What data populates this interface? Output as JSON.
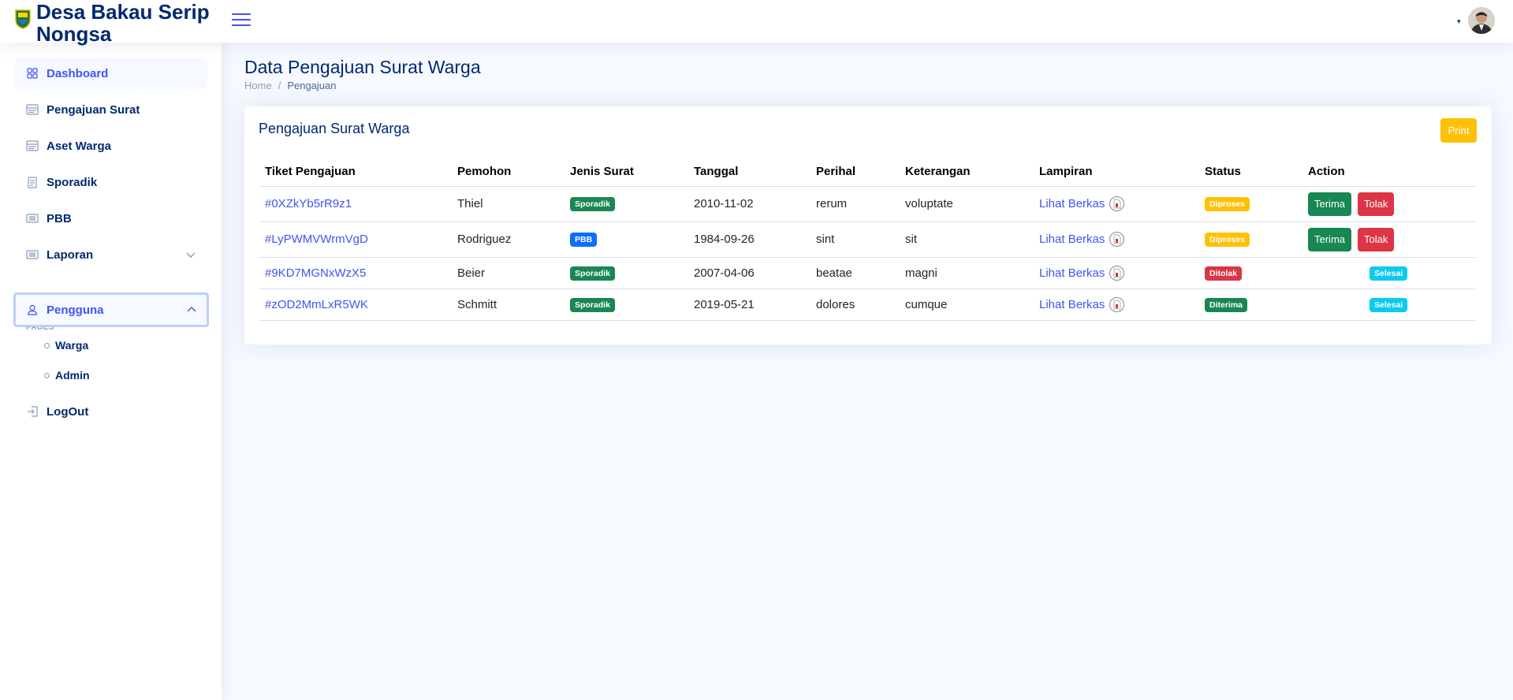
{
  "header": {
    "app_title": "Desa Bakau Serip Nongsa",
    "logo_icon": "village-emblem-icon",
    "menu_icon": "hamburger-icon",
    "profile_caret": "▾"
  },
  "sidebar": {
    "items": [
      {
        "label": "Dashboard",
        "icon": "grid-icon"
      },
      {
        "label": "Pengajuan Surat",
        "icon": "layout-text-icon"
      },
      {
        "label": "Aset Warga",
        "icon": "layout-text-icon"
      },
      {
        "label": "Sporadik",
        "icon": "file-text-icon"
      },
      {
        "label": "PBB",
        "icon": "card-list-icon"
      },
      {
        "label": "Laporan",
        "icon": "card-list-icon"
      }
    ],
    "heading": "Pages",
    "pengguna": {
      "label": "Pengguna",
      "icon": "person-icon",
      "subitems": [
        "Warga",
        "Admin"
      ]
    },
    "logout": {
      "label": "LogOut",
      "icon": "box-arrow-in-right-icon"
    }
  },
  "main": {
    "page_title": "Data Pengajuan Surat Warga",
    "breadcrumb": {
      "home": "Home",
      "separator": "/",
      "current": "Pengajuan"
    },
    "card": {
      "title": "Pengajuan Surat Warga",
      "print_label": "Print",
      "columns": [
        "Tiket Pengajuan",
        "Pemohon",
        "Jenis Surat",
        "Tanggal",
        "Perihal",
        "Keterangan",
        "Lampiran",
        "Status",
        "Action"
      ],
      "rows": [
        {
          "ticket": "#0XZkYb5rR9z1",
          "pemohon": "Thiel",
          "jenis": "Sporadik",
          "tanggal": "2010-11-02",
          "perihal": "rerum",
          "keterangan": "voluptate",
          "lampiran": "Lihat Berkas",
          "status": "Diproses",
          "actions": [
            "Terima",
            "Tolak"
          ]
        },
        {
          "ticket": "#LyPWMVWrmVgD",
          "pemohon": "Rodriguez",
          "jenis": "PBB",
          "tanggal": "1984-09-26",
          "perihal": "sint",
          "keterangan": "sit",
          "lampiran": "Lihat Berkas",
          "status": "Diproses",
          "actions": [
            "Terima",
            "Tolak"
          ]
        },
        {
          "ticket": "#9KD7MGNxWzX5",
          "pemohon": "Beier",
          "jenis": "Sporadik",
          "tanggal": "2007-04-06",
          "perihal": "beatae",
          "keterangan": "magni",
          "lampiran": "Lihat Berkas",
          "status": "Ditolak",
          "done": "Selesai"
        },
        {
          "ticket": "#zOD2MmLxR5WK",
          "pemohon": "Schmitt",
          "jenis": "Sporadik",
          "tanggal": "2019-05-21",
          "perihal": "dolores",
          "keterangan": "cumque",
          "lampiran": "Lihat Berkas",
          "status": "Diterima",
          "done": "Selesai"
        }
      ]
    }
  },
  "colors": {
    "primary": "#4154f1",
    "navy": "#012970",
    "success": "#198754",
    "danger": "#dc3545",
    "warning": "#ffc107",
    "info": "#0dcaf0",
    "blue": "#0d6efd"
  }
}
